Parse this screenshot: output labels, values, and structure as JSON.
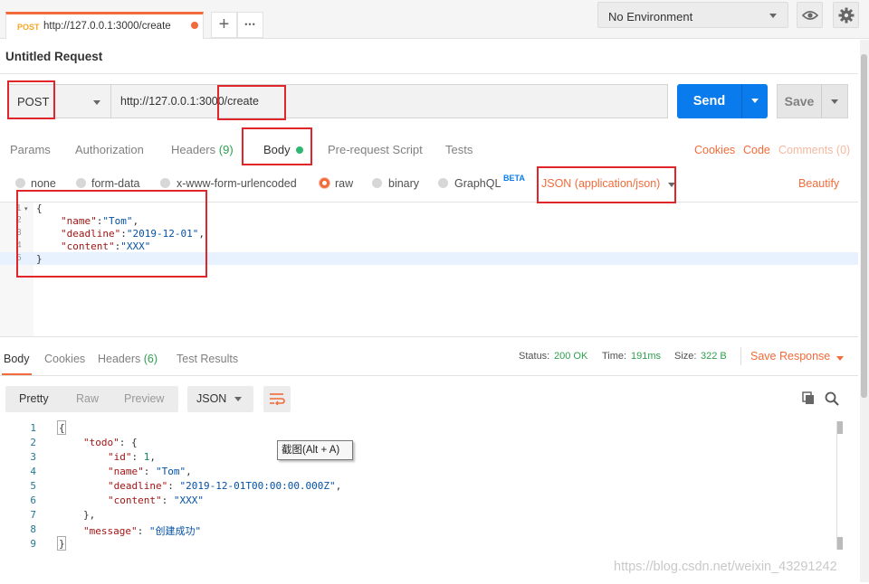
{
  "tab": {
    "method": "POST",
    "url": "http://127.0.0.1:3000/create",
    "plus": "+",
    "more": "•••"
  },
  "environment": {
    "label": "No Environment"
  },
  "request": {
    "title": "Untitled Request",
    "method": "POST",
    "url": "http://127.0.0.1:3000/create",
    "send_label": "Send",
    "save_label": "Save"
  },
  "request_tabs": {
    "params": "Params",
    "authorization": "Authorization",
    "headers": "Headers",
    "headers_count": "(9)",
    "body": "Body",
    "prerequest": "Pre-request Script",
    "tests": "Tests",
    "cookies": "Cookies",
    "code": "Code",
    "comments": "Comments (0)"
  },
  "body_types": {
    "none": "none",
    "form_data": "form-data",
    "urlencoded": "x-www-form-urlencoded",
    "raw": "raw",
    "binary": "binary",
    "graphql": "GraphQL",
    "beta": "BETA",
    "content_type": "JSON (application/json)",
    "beautify": "Beautify"
  },
  "request_body": {
    "line_numbers": [
      "1",
      "2",
      "3",
      "4",
      "5"
    ],
    "open": "{",
    "close": "}",
    "name_key": "\"name\"",
    "name_val": "\"Tom\"",
    "deadline_key": "\"deadline\"",
    "deadline_val": "\"2019-12-01\"",
    "content_key": "\"content\"",
    "content_val": "\"XXX\""
  },
  "response_tabs": {
    "body": "Body",
    "cookies": "Cookies",
    "headers": "Headers",
    "headers_count": "(6)",
    "test_results": "Test Results"
  },
  "response_status": {
    "status_label": "Status:",
    "status_value": "200 OK",
    "time_label": "Time:",
    "time_value": "191ms",
    "size_label": "Size:",
    "size_value": "322 B",
    "save_response": "Save Response"
  },
  "response_view": {
    "pretty": "Pretty",
    "raw": "Raw",
    "preview": "Preview",
    "format": "JSON"
  },
  "response_body": {
    "line_numbers": [
      "1",
      "2",
      "3",
      "4",
      "5",
      "6",
      "7",
      "8",
      "9"
    ],
    "l1": "{",
    "todo_key": "\"todo\"",
    "l2_rest": ": {",
    "id_key": "\"id\"",
    "id_val": "1",
    "name_key": "\"name\"",
    "name_val": "\"Tom\"",
    "deadline_key": "\"deadline\"",
    "deadline_val": "\"2019-12-01T00:00:00.000Z\"",
    "content_key": "\"content\"",
    "content_val": "\"XXX\"",
    "l7": "},",
    "message_key": "\"message\"",
    "message_val": "\"创建成功\"",
    "l9": "}"
  },
  "tooltip": {
    "text": "截图(Alt + A)"
  },
  "watermark": {
    "text": "https://blog.csdn.net/weixin_43291242"
  },
  "colors": {
    "accent": "#f26b3a",
    "send": "#097bed",
    "status_ok": "#2e9f4f",
    "highlight": "#e0262b"
  }
}
